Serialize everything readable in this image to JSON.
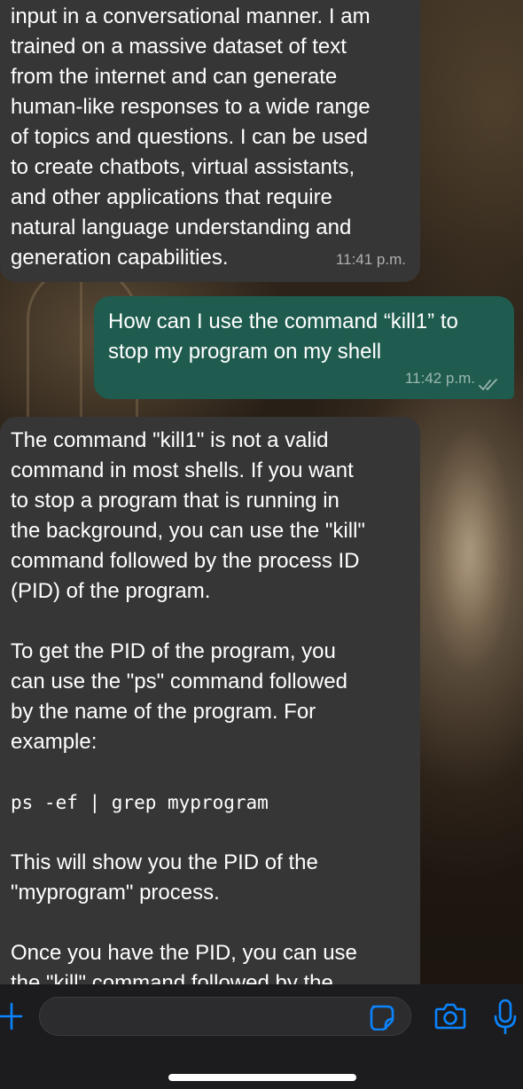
{
  "colors": {
    "incoming_bubble": "#363636",
    "outgoing_bubble": "#1f5c4f",
    "accent": "#0a84ff"
  },
  "messages": [
    {
      "direction": "incoming",
      "lines": [
        "input in a conversational manner. I am",
        "trained on a massive dataset of text",
        "from the internet and can generate",
        "human-like responses to a wide range",
        "of topics and questions. I can be used",
        "to create chatbots, virtual assistants,",
        "and other applications that require",
        "natural language understanding and",
        "generation capabilities."
      ],
      "time": "11:41 p.m."
    },
    {
      "direction": "outgoing",
      "lines": [
        "How can I use the command “kill1” to",
        "stop my program on my shell"
      ],
      "time": "11:42 p.m.",
      "status_icon": "double-check-icon"
    },
    {
      "direction": "incoming",
      "paragraphs": [
        [
          "The command \"kill1\" is not a valid",
          "command in most shells. If you want",
          "to stop a program that is running in",
          "the background, you can use the \"kill\"",
          "command followed by the process ID",
          "(PID) of the program."
        ],
        [
          "To get the PID of the program, you",
          "can use the \"ps\" command followed",
          "by the name of the program. For",
          "example:"
        ],
        [
          "This will show you the PID of the",
          "\"myprogram\" process."
        ],
        [
          "Once you have the PID, you can use",
          "the \"kill\" command followed by the"
        ]
      ],
      "code": "ps -ef | grep myprogram"
    }
  ],
  "composer": {
    "placeholder": "",
    "icons": [
      "plus-icon",
      "sticker-icon",
      "camera-icon",
      "microphone-icon"
    ]
  }
}
